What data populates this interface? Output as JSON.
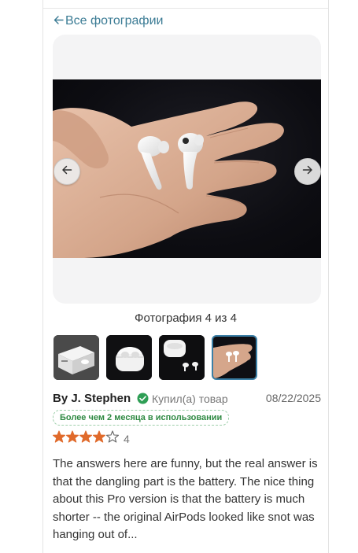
{
  "back_link": {
    "label": "Все фотографии",
    "icon": "arrow-left-icon"
  },
  "viewer": {
    "counter": "Фотография 4 из 4",
    "current_index": 4,
    "total": 4,
    "prev_icon": "arrow-left-icon",
    "next_icon": "arrow-right-icon"
  },
  "thumbnails": [
    {
      "alt": "AirPods Pro box"
    },
    {
      "alt": "AirPods Pro case"
    },
    {
      "alt": "Open case with earbuds"
    },
    {
      "alt": "Earbuds in hand",
      "active": true
    }
  ],
  "review": {
    "author": "By J. Stephen",
    "verified_label": "Купил(а) товар",
    "date": "08/22/2025",
    "usage_badge": "Более чем 2 месяца в использовании",
    "rating": 4,
    "rating_max": 5,
    "rating_text": "4",
    "text": "The answers here are funny, but the real answer is that the dangling part is the battery. The nice thing about this Pro version is that the battery is much shorter -- the original AirPods looked like snot was hanging out of..."
  },
  "colors": {
    "link": "#3c7c95",
    "star": "#e06a2b",
    "verified": "#2e9e55",
    "badge": "#2f8a43"
  }
}
